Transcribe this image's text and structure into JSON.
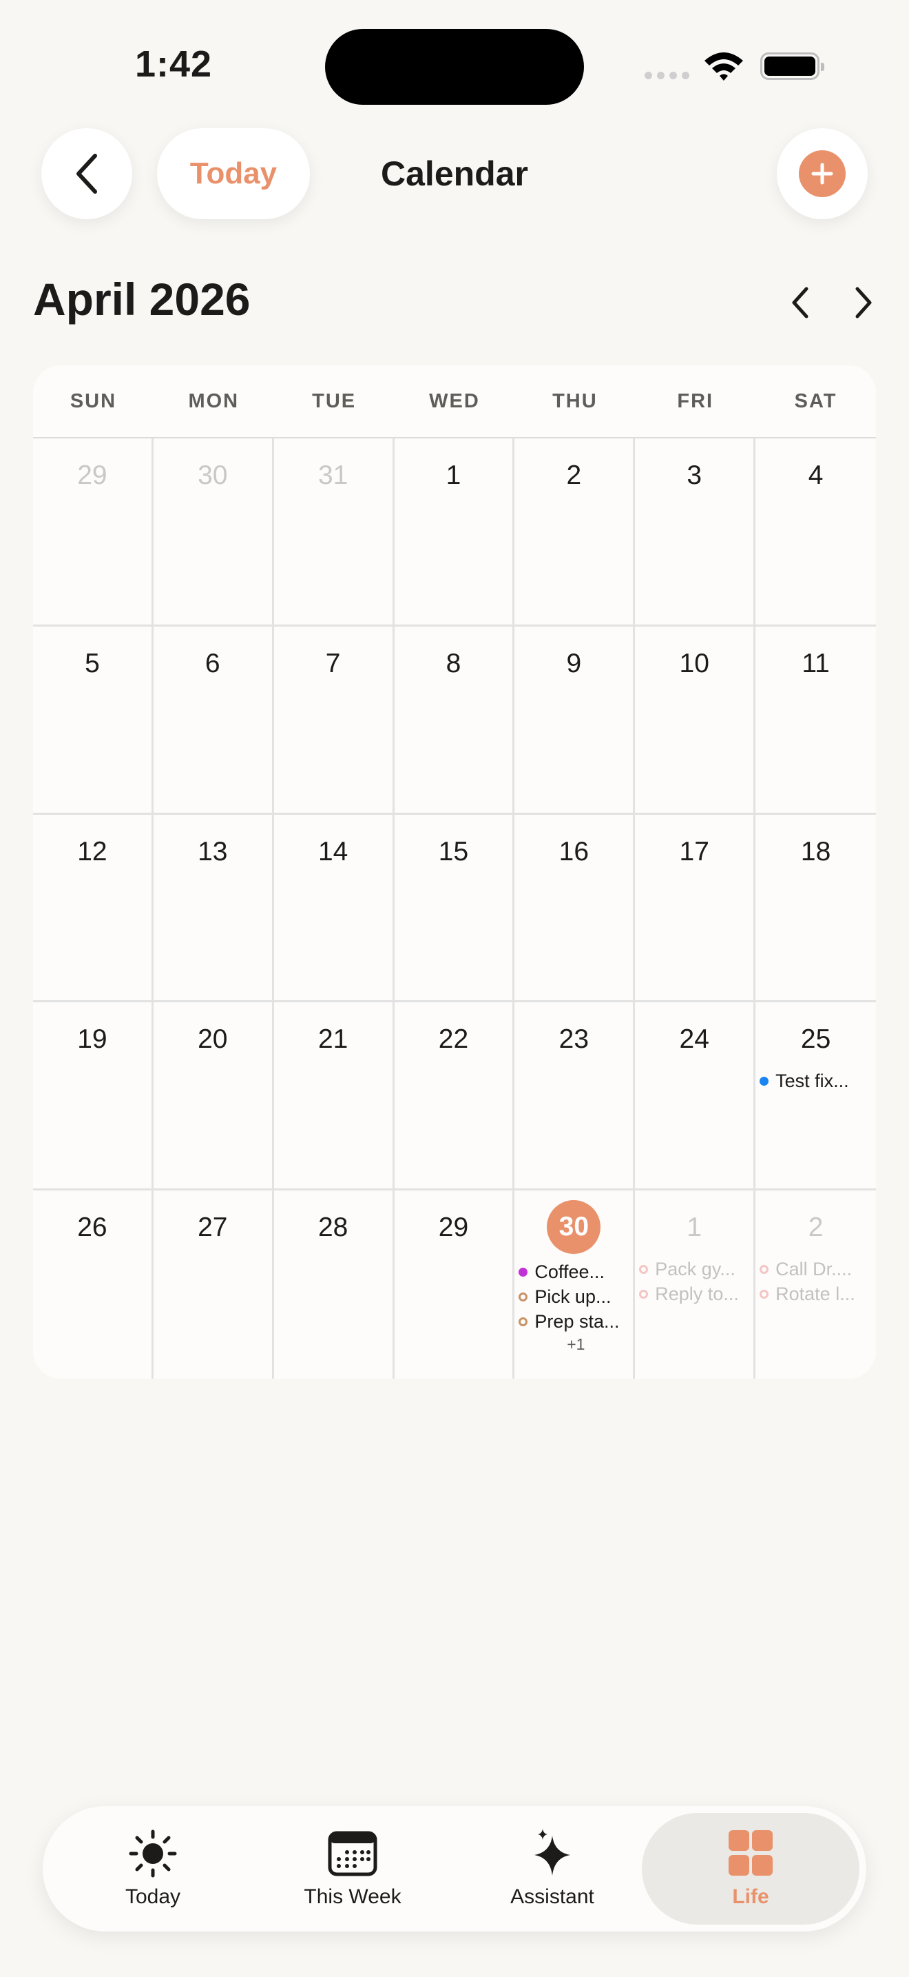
{
  "status": {
    "time": "1:42"
  },
  "header": {
    "today_label": "Today",
    "title": "Calendar"
  },
  "month_label": "April 2026",
  "colors": {
    "accent": "#e9916a",
    "event_blue": "#1a84f0",
    "event_purple": "#c132d6",
    "event_ring": "#c69266"
  },
  "weekdays": [
    "SUN",
    "MON",
    "TUE",
    "WED",
    "THU",
    "FRI",
    "SAT"
  ],
  "weeks": [
    [
      {
        "day": "29",
        "muted": true
      },
      {
        "day": "30",
        "muted": true
      },
      {
        "day": "31",
        "muted": true
      },
      {
        "day": "1"
      },
      {
        "day": "2"
      },
      {
        "day": "3"
      },
      {
        "day": "4"
      }
    ],
    [
      {
        "day": "5"
      },
      {
        "day": "6"
      },
      {
        "day": "7"
      },
      {
        "day": "8"
      },
      {
        "day": "9"
      },
      {
        "day": "10"
      },
      {
        "day": "11"
      }
    ],
    [
      {
        "day": "12"
      },
      {
        "day": "13"
      },
      {
        "day": "14"
      },
      {
        "day": "15"
      },
      {
        "day": "16"
      },
      {
        "day": "17"
      },
      {
        "day": "18"
      }
    ],
    [
      {
        "day": "19"
      },
      {
        "day": "20"
      },
      {
        "day": "21"
      },
      {
        "day": "22"
      },
      {
        "day": "23"
      },
      {
        "day": "24"
      },
      {
        "day": "25",
        "events": [
          {
            "title": "Test fix...",
            "marker": "dot-blue"
          }
        ]
      }
    ],
    [
      {
        "day": "26"
      },
      {
        "day": "27"
      },
      {
        "day": "28"
      },
      {
        "day": "29"
      },
      {
        "day": "30",
        "today": true,
        "events": [
          {
            "title": "Coffee...",
            "marker": "dot-purple"
          },
          {
            "title": "Pick up...",
            "marker": "ring"
          },
          {
            "title": "Prep sta...",
            "marker": "ring"
          }
        ],
        "more": "+1"
      },
      {
        "day": "1",
        "muted": true,
        "events": [
          {
            "title": "Pack gy...",
            "marker": "ring"
          },
          {
            "title": "Reply to...",
            "marker": "ring"
          }
        ]
      },
      {
        "day": "2",
        "muted": true,
        "events": [
          {
            "title": "Call Dr....",
            "marker": "ring"
          },
          {
            "title": "Rotate l...",
            "marker": "ring"
          }
        ]
      }
    ]
  ],
  "tabs": [
    {
      "label": "Today",
      "icon": "sun-icon"
    },
    {
      "label": "This Week",
      "icon": "calendar-icon"
    },
    {
      "label": "Assistant",
      "icon": "sparkle-icon"
    },
    {
      "label": "Life",
      "icon": "grid-icon",
      "active": true
    }
  ]
}
